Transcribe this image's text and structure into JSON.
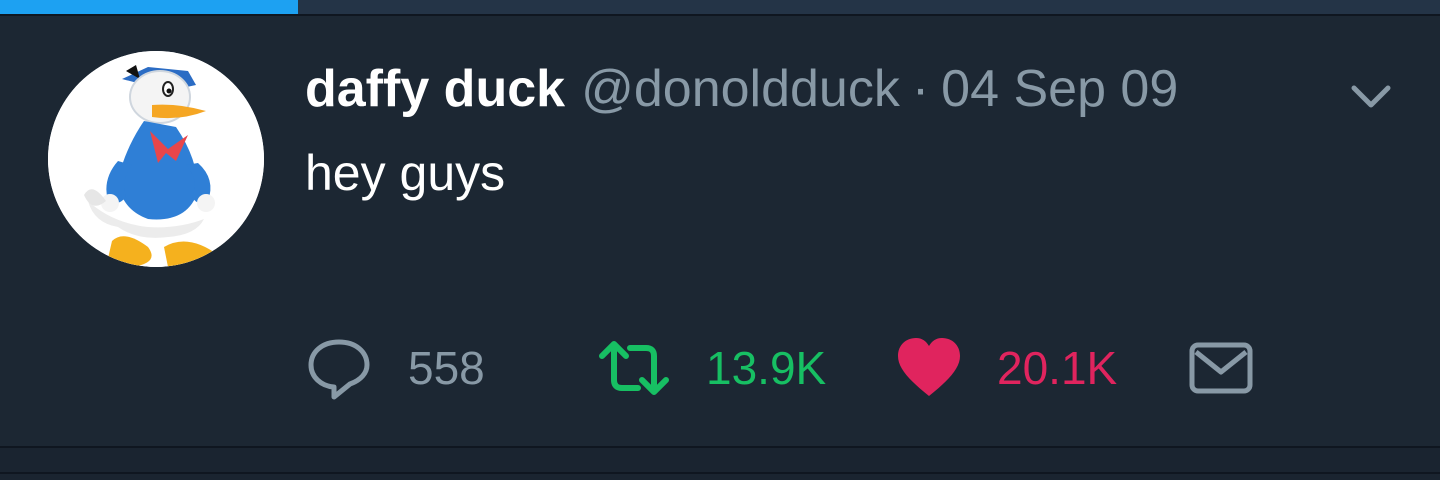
{
  "progress": {
    "fraction": 0.207,
    "color": "#1da1f2"
  },
  "tweet": {
    "display_name": "daffy duck",
    "handle": "@donoldduck",
    "separator": "·",
    "date": "04 Sep 09",
    "text": "hey guys",
    "avatar": {
      "icon": "donald-duck-avatar"
    },
    "menu_icon": "chevron-down-icon"
  },
  "actions": {
    "reply": {
      "icon": "reply-icon",
      "count": "558",
      "color": "#8899a6"
    },
    "retweet": {
      "icon": "retweet-icon",
      "count": "13.9K",
      "color": "#17bf63"
    },
    "like": {
      "icon": "heart-icon",
      "count": "20.1K",
      "color": "#e0245e"
    },
    "dm": {
      "icon": "mail-icon",
      "color": "#8899a6"
    }
  }
}
